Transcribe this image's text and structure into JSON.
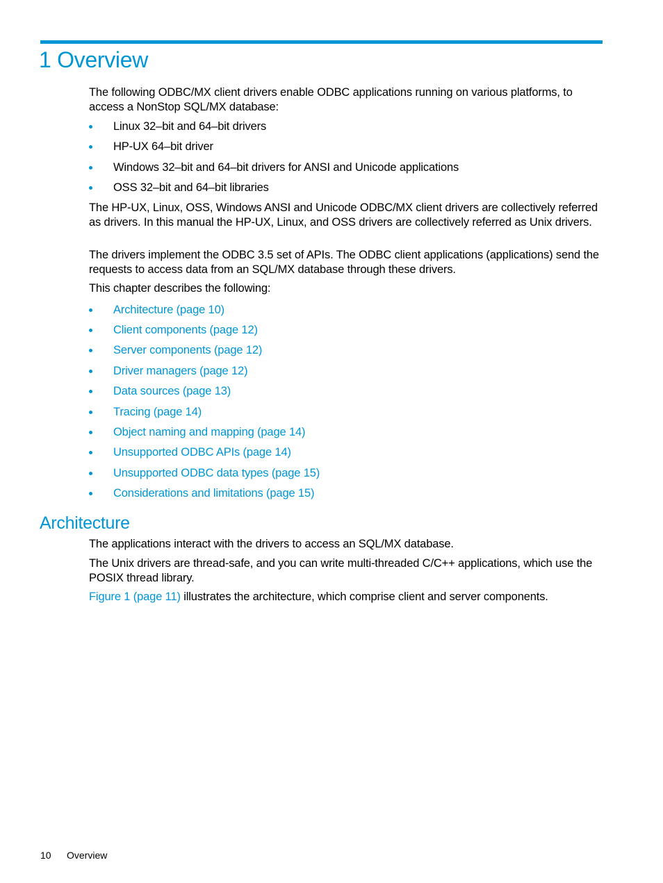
{
  "chapter": {
    "title": "1 Overview",
    "intro": "The following ODBC/MX client drivers enable ODBC applications running on various platforms, to access a NonStop SQL/MX database:",
    "drivers": [
      "Linux 32–bit and 64–bit drivers",
      "HP-UX 64–bit driver",
      "Windows 32–bit and 64–bit drivers for ANSI and Unicode applications",
      "OSS 32–bit and 64–bit libraries"
    ],
    "paragraphs": [
      "The HP-UX, Linux, OSS, Windows ANSI and Unicode ODBC/MX client drivers are collectively referred as drivers. In this manual the HP-UX, Linux, and OSS drivers are collectively referred as Unix drivers.",
      "The drivers implement the ODBC 3.5 set of APIs. The ODBC client applications (applications) send the requests to access data from an SQL/MX database through these drivers.",
      "This chapter describes the following:"
    ],
    "toc_links": [
      "Architecture (page 10)",
      "Client components (page 12)",
      "Server components (page 12)",
      "Driver managers (page 12)",
      "Data sources (page 13)",
      "Tracing (page 14)",
      "Object naming and mapping (page 14)",
      "Unsupported ODBC APIs (page 14)",
      "Unsupported ODBC data types (page 15)",
      "Considerations and limitations (page 15)"
    ]
  },
  "architecture": {
    "heading": "Architecture",
    "paragraphs": [
      "The applications interact with the drivers to access an SQL/MX database.",
      "The Unix drivers are thread-safe, and you can write multi-threaded C/C++ applications, which use the POSIX thread library."
    ],
    "figure_link": "Figure 1 (page 11)",
    "figure_text": " illustrates the architecture, which comprise client and server components."
  },
  "footer": {
    "page_number": "10",
    "section": "Overview"
  },
  "colors": {
    "accent": "#0096d6",
    "text": "#000000"
  }
}
